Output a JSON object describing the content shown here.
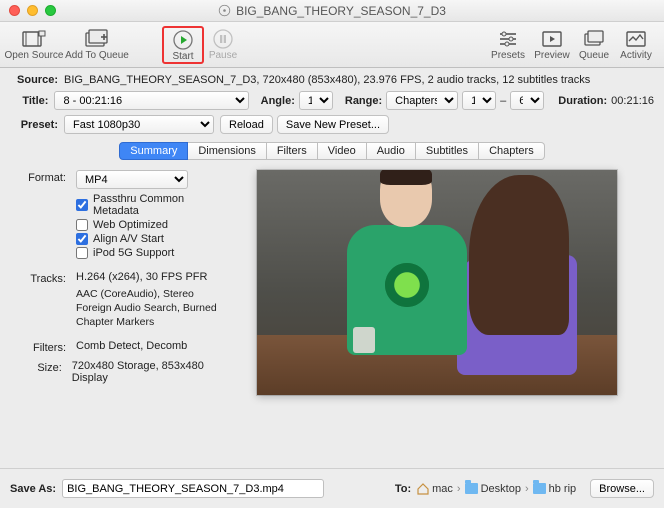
{
  "window": {
    "title": "BIG_BANG_THEORY_SEASON_7_D3"
  },
  "toolbar": {
    "open_source": "Open Source",
    "add_to_queue": "Add To Queue",
    "start": "Start",
    "pause": "Pause",
    "presets": "Presets",
    "preview": "Preview",
    "queue": "Queue",
    "activity": "Activity"
  },
  "source": {
    "label": "Source:",
    "value": "BIG_BANG_THEORY_SEASON_7_D3, 720x480 (853x480), 23.976 FPS, 2 audio tracks, 12 subtitles tracks"
  },
  "title": {
    "label": "Title:",
    "value": "8 - 00:21:16",
    "angle_label": "Angle:",
    "angle_value": "1",
    "range_label": "Range:",
    "range_type": "Chapters",
    "range_from": "1",
    "range_sep": "–",
    "range_to": "6",
    "duration_label": "Duration:",
    "duration_value": "00:21:16"
  },
  "preset": {
    "label": "Preset:",
    "value": "Fast 1080p30",
    "reload": "Reload",
    "save_new": "Save New Preset..."
  },
  "tabs": [
    "Summary",
    "Dimensions",
    "Filters",
    "Video",
    "Audio",
    "Subtitles",
    "Chapters"
  ],
  "summary": {
    "format_label": "Format:",
    "format_value": "MP4",
    "checks": {
      "passthru": "Passthru Common Metadata",
      "web": "Web Optimized",
      "align": "Align A/V Start",
      "ipod": "iPod 5G Support"
    },
    "tracks_label": "Tracks:",
    "tracks_lines": [
      "H.264 (x264), 30 FPS PFR",
      "AAC (CoreAudio), Stereo",
      "Foreign Audio Search, Burned",
      "Chapter Markers"
    ],
    "filters_label": "Filters:",
    "filters_value": "Comb Detect, Decomb",
    "size_label": "Size:",
    "size_value": "720x480 Storage, 853x480 Display"
  },
  "save": {
    "label": "Save As:",
    "filename": "BIG_BANG_THEORY_SEASON_7_D3.mp4",
    "to_label": "To:",
    "path": [
      "mac",
      "Desktop",
      "hb rip"
    ],
    "browse": "Browse..."
  }
}
